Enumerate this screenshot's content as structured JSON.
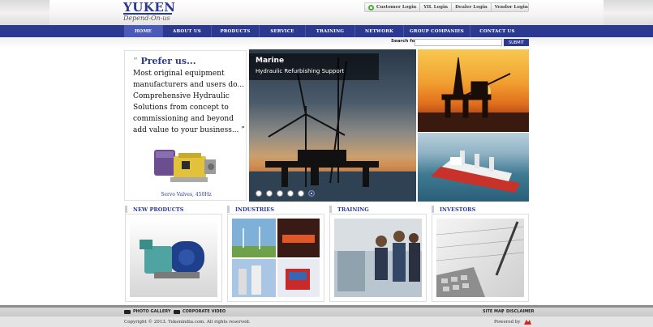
{
  "brand": {
    "name": "YUKEN",
    "tagline": "Depend-On-us"
  },
  "login": [
    "Customer Login",
    "YIL Login",
    "Dealer Login",
    "Vendor Login"
  ],
  "nav": [
    {
      "label": "HOME",
      "active": true
    },
    {
      "label": "ABOUT US"
    },
    {
      "label": "PRODUCTS"
    },
    {
      "label": "SERVICE"
    },
    {
      "label": "TRAINING"
    },
    {
      "label": "NETWORK"
    },
    {
      "label": "GROUP COMPANIES"
    },
    {
      "label": "CONTACT US"
    }
  ],
  "search": {
    "label": "Search for:",
    "placeholder": "",
    "button": "SUBMIT"
  },
  "promo": {
    "open_quote": "“",
    "heading": "Prefer us...",
    "body": "Most original equipment manufacturers and users do... Comprehensive Hydraulic Solutions from concept to commissioning and beyond add value to your business...",
    "close_quote": "”",
    "caption": "Servo Valves, 450Hz"
  },
  "slider": {
    "title": "Marine",
    "subtitle": "Hydraulic Refurbishing Support",
    "active_index": 5,
    "slide_count": 6
  },
  "sections": [
    {
      "heading": "NEW PRODUCTS"
    },
    {
      "heading": "INDUSTRIES"
    },
    {
      "heading": "TRAINING"
    },
    {
      "heading": "INVESTORS"
    }
  ],
  "footer": {
    "photo_gallery": "PHOTO GALLERY",
    "corporate_video": "CORPORATE VIDEO",
    "sitemap": "SITE MAP",
    "separator": "|",
    "disclaimer": "DISCLAIMER",
    "copyright": "Copyright © 2013. Yukenindia.com. All rights reserved.",
    "powered_by": "Powered by"
  },
  "colors": {
    "brand_blue": "#2b3990",
    "nav_active": "#4a5ab8"
  }
}
